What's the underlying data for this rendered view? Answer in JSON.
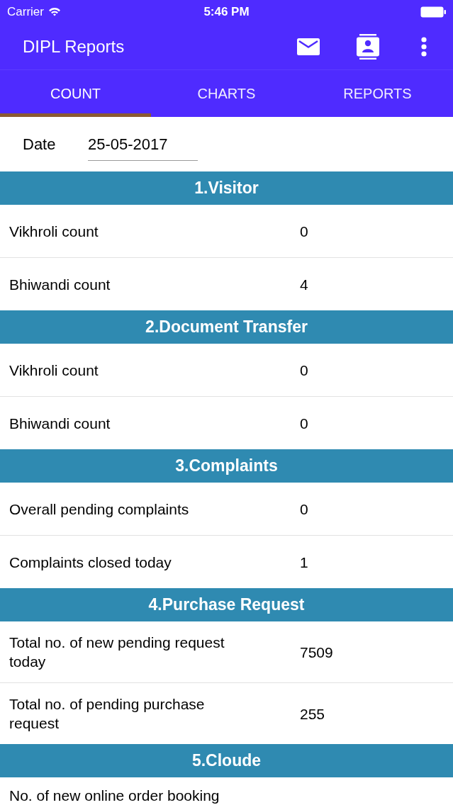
{
  "status_bar": {
    "carrier": "Carrier",
    "time": "5:46 PM"
  },
  "app_bar": {
    "title": "DIPL Reports"
  },
  "tabs": [
    {
      "label": "COUNT",
      "selected": true
    },
    {
      "label": "CHARTS",
      "selected": false
    },
    {
      "label": "REPORTS",
      "selected": false
    }
  ],
  "date_field": {
    "label": "Date",
    "value": "25-05-2017"
  },
  "sections": [
    {
      "title": "1.Visitor",
      "rows": [
        {
          "label": "Vikhroli count",
          "value": "0"
        },
        {
          "label": "Bhiwandi count",
          "value": "4"
        }
      ]
    },
    {
      "title": "2.Document Transfer",
      "rows": [
        {
          "label": "Vikhroli count",
          "value": "0"
        },
        {
          "label": "Bhiwandi count",
          "value": "0"
        }
      ]
    },
    {
      "title": "3.Complaints",
      "rows": [
        {
          "label": "Overall pending complaints",
          "value": "0"
        },
        {
          "label": "Complaints closed today",
          "value": "1"
        }
      ]
    },
    {
      "title": "4.Purchase Request",
      "rows": [
        {
          "label": "Total no. of new pending request today",
          "value": "7509"
        },
        {
          "label": "Total no. of pending purchase request",
          "value": "255"
        }
      ]
    },
    {
      "title": "5.Cloude",
      "rows": [
        {
          "label": "No. of new online order booking"
        }
      ]
    }
  ]
}
